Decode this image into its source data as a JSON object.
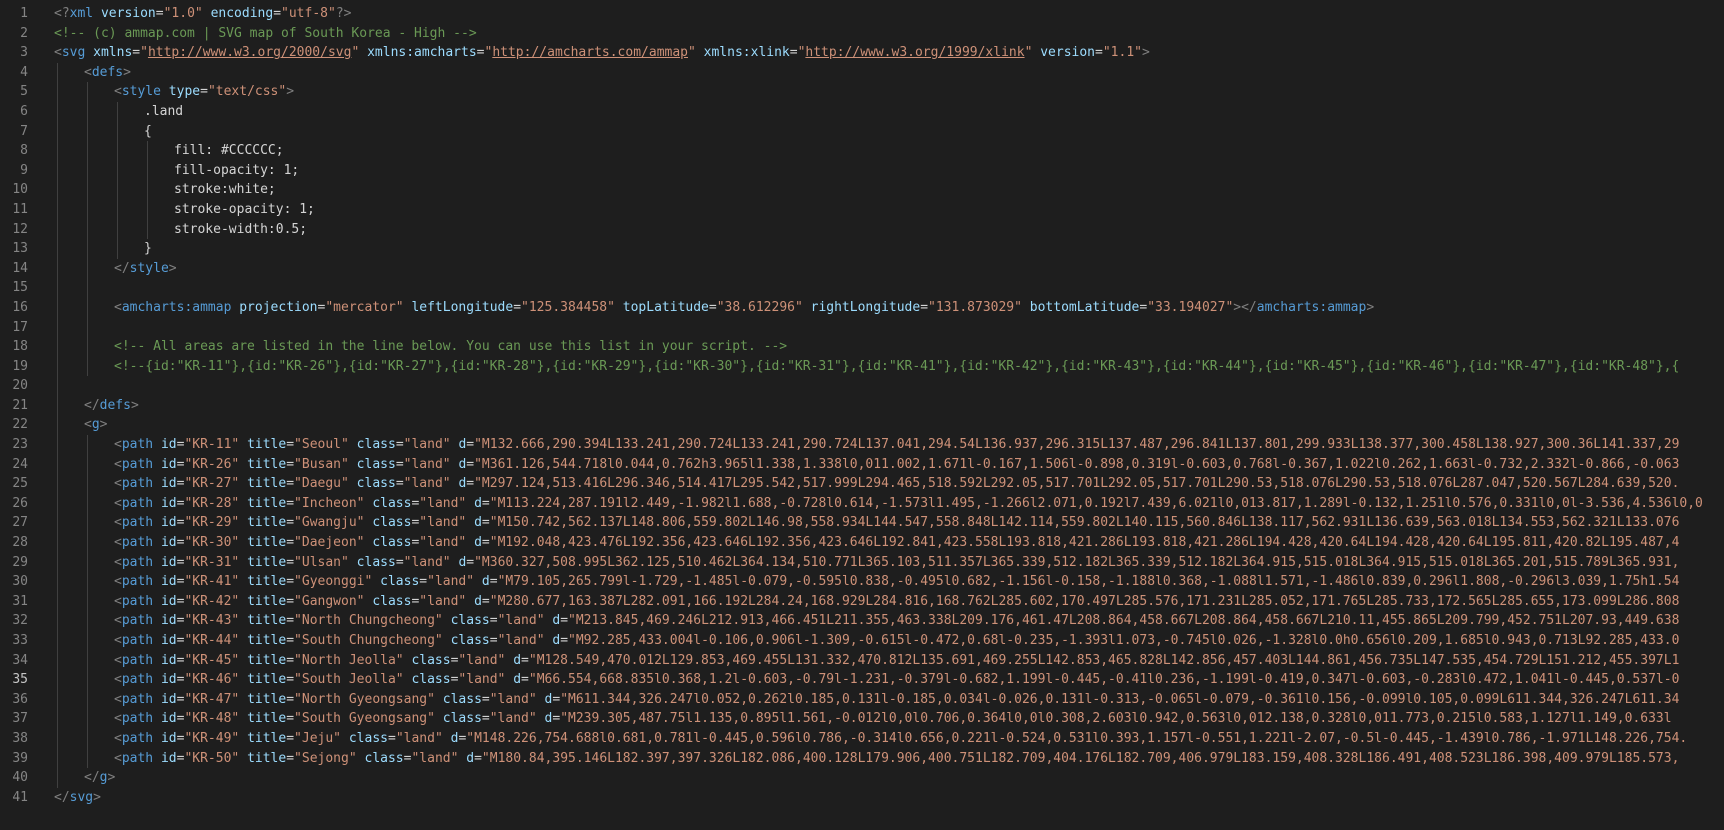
{
  "editor": {
    "lines": [
      {
        "n": "1",
        "indent": 0,
        "tokens": [
          {
            "t": "<?",
            "c": "punc"
          },
          {
            "t": "xml",
            "c": "tag"
          },
          {
            "t": " ",
            "c": "text"
          },
          {
            "t": "version",
            "c": "attr"
          },
          {
            "t": "=",
            "c": "eq"
          },
          {
            "t": "\"1.0\"",
            "c": "str"
          },
          {
            "t": " ",
            "c": "text"
          },
          {
            "t": "encoding",
            "c": "attr"
          },
          {
            "t": "=",
            "c": "eq"
          },
          {
            "t": "\"utf-8\"",
            "c": "str"
          },
          {
            "t": "?>",
            "c": "punc"
          }
        ]
      },
      {
        "n": "2",
        "indent": 0,
        "tokens": [
          {
            "t": "<!-- (c) ammap.com | SVG map of South Korea - High -->",
            "c": "comment"
          }
        ]
      },
      {
        "n": "3",
        "indent": 0,
        "tokens": [
          {
            "t": "<",
            "c": "punc"
          },
          {
            "t": "svg",
            "c": "tag"
          },
          {
            "t": " ",
            "c": "text"
          },
          {
            "t": "xmlns",
            "c": "attr"
          },
          {
            "t": "=",
            "c": "eq"
          },
          {
            "t": "\"",
            "c": "str"
          },
          {
            "t": "http://www.w3.org/2000/svg",
            "c": "link"
          },
          {
            "t": "\"",
            "c": "str"
          },
          {
            "t": " ",
            "c": "text"
          },
          {
            "t": "xmlns:amcharts",
            "c": "attr"
          },
          {
            "t": "=",
            "c": "eq"
          },
          {
            "t": "\"",
            "c": "str"
          },
          {
            "t": "http://amcharts.com/ammap",
            "c": "link"
          },
          {
            "t": "\"",
            "c": "str"
          },
          {
            "t": " ",
            "c": "text"
          },
          {
            "t": "xmlns:xlink",
            "c": "attr"
          },
          {
            "t": "=",
            "c": "eq"
          },
          {
            "t": "\"",
            "c": "str"
          },
          {
            "t": "http://www.w3.org/1999/xlink",
            "c": "link"
          },
          {
            "t": "\"",
            "c": "str"
          },
          {
            "t": " ",
            "c": "text"
          },
          {
            "t": "version",
            "c": "attr"
          },
          {
            "t": "=",
            "c": "eq"
          },
          {
            "t": "\"1.1\"",
            "c": "str"
          },
          {
            "t": ">",
            "c": "punc"
          }
        ]
      },
      {
        "n": "4",
        "indent": 1,
        "tokens": [
          {
            "t": "<",
            "c": "punc"
          },
          {
            "t": "defs",
            "c": "tag"
          },
          {
            "t": ">",
            "c": "punc"
          }
        ]
      },
      {
        "n": "5",
        "indent": 2,
        "tokens": [
          {
            "t": "<",
            "c": "punc"
          },
          {
            "t": "style",
            "c": "tag"
          },
          {
            "t": " ",
            "c": "text"
          },
          {
            "t": "type",
            "c": "attr"
          },
          {
            "t": "=",
            "c": "eq"
          },
          {
            "t": "\"text/css\"",
            "c": "str"
          },
          {
            "t": ">",
            "c": "punc"
          }
        ]
      },
      {
        "n": "6",
        "indent": 3,
        "tokens": [
          {
            "t": ".land",
            "c": "text"
          }
        ]
      },
      {
        "n": "7",
        "indent": 3,
        "tokens": [
          {
            "t": "{",
            "c": "text"
          }
        ]
      },
      {
        "n": "8",
        "indent": 4,
        "tokens": [
          {
            "t": "fill: #CCCCCC;",
            "c": "text"
          }
        ]
      },
      {
        "n": "9",
        "indent": 4,
        "tokens": [
          {
            "t": "fill-opacity: 1;",
            "c": "text"
          }
        ]
      },
      {
        "n": "10",
        "indent": 4,
        "tokens": [
          {
            "t": "stroke:white;",
            "c": "text"
          }
        ]
      },
      {
        "n": "11",
        "indent": 4,
        "tokens": [
          {
            "t": "stroke-opacity: 1;",
            "c": "text"
          }
        ]
      },
      {
        "n": "12",
        "indent": 4,
        "tokens": [
          {
            "t": "stroke-width:0.5;",
            "c": "text"
          }
        ]
      },
      {
        "n": "13",
        "indent": 3,
        "tokens": [
          {
            "t": "}",
            "c": "text"
          }
        ]
      },
      {
        "n": "14",
        "indent": 2,
        "tokens": [
          {
            "t": "</",
            "c": "punc"
          },
          {
            "t": "style",
            "c": "tag"
          },
          {
            "t": ">",
            "c": "punc"
          }
        ]
      },
      {
        "n": "15",
        "indent": 2,
        "tokens": []
      },
      {
        "n": "16",
        "indent": 2,
        "tokens": [
          {
            "t": "<",
            "c": "punc"
          },
          {
            "t": "amcharts:ammap",
            "c": "tag"
          },
          {
            "t": " ",
            "c": "text"
          },
          {
            "t": "projection",
            "c": "attr"
          },
          {
            "t": "=",
            "c": "eq"
          },
          {
            "t": "\"mercator\"",
            "c": "str"
          },
          {
            "t": " ",
            "c": "text"
          },
          {
            "t": "leftLongitude",
            "c": "attr"
          },
          {
            "t": "=",
            "c": "eq"
          },
          {
            "t": "\"125.384458\"",
            "c": "str"
          },
          {
            "t": " ",
            "c": "text"
          },
          {
            "t": "topLatitude",
            "c": "attr"
          },
          {
            "t": "=",
            "c": "eq"
          },
          {
            "t": "\"38.612296\"",
            "c": "str"
          },
          {
            "t": " ",
            "c": "text"
          },
          {
            "t": "rightLongitude",
            "c": "attr"
          },
          {
            "t": "=",
            "c": "eq"
          },
          {
            "t": "\"131.873029\"",
            "c": "str"
          },
          {
            "t": " ",
            "c": "text"
          },
          {
            "t": "bottomLatitude",
            "c": "attr"
          },
          {
            "t": "=",
            "c": "eq"
          },
          {
            "t": "\"33.194027\"",
            "c": "str"
          },
          {
            "t": "></",
            "c": "punc"
          },
          {
            "t": "amcharts:ammap",
            "c": "tag"
          },
          {
            "t": ">",
            "c": "punc"
          }
        ]
      },
      {
        "n": "17",
        "indent": 2,
        "tokens": []
      },
      {
        "n": "18",
        "indent": 2,
        "tokens": [
          {
            "t": "<!-- All areas are listed in the line below. You can use this list in your script. -->",
            "c": "comment"
          }
        ]
      },
      {
        "n": "19",
        "indent": 2,
        "tokens": [
          {
            "t": "<!--{id:\"KR-11\"},{id:\"KR-26\"},{id:\"KR-27\"},{id:\"KR-28\"},{id:\"KR-29\"},{id:\"KR-30\"},{id:\"KR-31\"},{id:\"KR-41\"},{id:\"KR-42\"},{id:\"KR-43\"},{id:\"KR-44\"},{id:\"KR-45\"},{id:\"KR-46\"},{id:\"KR-47\"},{id:\"KR-48\"},{",
            "c": "comment"
          }
        ]
      },
      {
        "n": "20",
        "indent": 1,
        "tokens": []
      },
      {
        "n": "21",
        "indent": 1,
        "tokens": [
          {
            "t": "</",
            "c": "punc"
          },
          {
            "t": "defs",
            "c": "tag"
          },
          {
            "t": ">",
            "c": "punc"
          }
        ]
      },
      {
        "n": "22",
        "indent": 1,
        "tokens": [
          {
            "t": "<",
            "c": "punc"
          },
          {
            "t": "g",
            "c": "tag"
          },
          {
            "t": ">",
            "c": "punc"
          }
        ]
      },
      {
        "n": "23",
        "indent": 2,
        "path": true,
        "id": "\"KR-11\"",
        "title": "\"Seoul\"",
        "d": "\"M132.666,290.394L133.241,290.724L133.241,290.724L137.041,294.54L136.937,296.315L137.487,296.841L137.801,299.933L138.377,300.458L138.927,300.36L141.337,29"
      },
      {
        "n": "24",
        "indent": 2,
        "path": true,
        "id": "\"KR-26\"",
        "title": "\"Busan\"",
        "d": "\"M361.126,544.718l0.044,0.762h3.965l1.338,1.338l0,011.002,1.671l-0.167,1.506l-0.898,0.319l-0.603,0.768l-0.367,1.022l0.262,1.663l-0.732,2.332l-0.866,-0.063"
      },
      {
        "n": "25",
        "indent": 2,
        "path": true,
        "id": "\"KR-27\"",
        "title": "\"Daegu\"",
        "d": "\"M297.124,513.416L296.346,514.417L295.542,517.999L294.465,518.592L292.05,517.701L292.05,517.701L290.53,518.076L290.53,518.076L287.047,520.567L284.639,520."
      },
      {
        "n": "26",
        "indent": 2,
        "path": true,
        "id": "\"KR-28\"",
        "title": "\"Incheon\"",
        "d": "\"M113.224,287.191l2.449,-1.982l1.688,-0.728l0.614,-1.573l1.495,-1.266l2.071,0.192l7.439,6.021l0,013.817,1.289l-0.132,1.251l0.576,0.331l0,0l-3.536,4.536l0,0"
      },
      {
        "n": "27",
        "indent": 2,
        "path": true,
        "id": "\"KR-29\"",
        "title": "\"Gwangju\"",
        "d": "\"M150.742,562.137L148.806,559.802L146.98,558.934L144.547,558.848L142.114,559.802L140.115,560.846L138.117,562.931L136.639,563.018L134.553,562.321L133.076"
      },
      {
        "n": "28",
        "indent": 2,
        "path": true,
        "id": "\"KR-30\"",
        "title": "\"Daejeon\"",
        "d": "\"M192.048,423.476L192.356,423.646L192.356,423.646L192.841,423.558L193.818,421.286L193.818,421.286L194.428,420.64L194.428,420.64L195.811,420.82L195.487,4"
      },
      {
        "n": "29",
        "indent": 2,
        "path": true,
        "id": "\"KR-31\"",
        "title": "\"Ulsan\"",
        "d": "\"M360.327,508.995L362.125,510.462L364.134,510.771L365.103,511.357L365.339,512.182L365.339,512.182L364.915,515.018L364.915,515.018L365.201,515.789L365.931,"
      },
      {
        "n": "30",
        "indent": 2,
        "path": true,
        "id": "\"KR-41\"",
        "title": "\"Gyeonggi\"",
        "d": "\"M79.105,265.799l-1.729,-1.485l-0.079,-0.595l0.838,-0.495l0.682,-1.156l-0.158,-1.188l0.368,-1.088l1.571,-1.486l0.839,0.296l1.808,-0.296l3.039,1.75h1.54"
      },
      {
        "n": "31",
        "indent": 2,
        "path": true,
        "id": "\"KR-42\"",
        "title": "\"Gangwon\"",
        "d": "\"M280.677,163.387L282.091,166.192L284.24,168.929L284.816,168.762L285.602,170.497L285.576,171.231L285.052,171.765L285.733,172.565L285.655,173.099L286.808"
      },
      {
        "n": "32",
        "indent": 2,
        "path": true,
        "id": "\"KR-43\"",
        "title": "\"North Chungcheong\"",
        "d": "\"M213.845,469.246L212.913,466.451L211.355,463.338L209.176,461.47L208.864,458.667L208.864,458.667L210.11,455.865L209.799,452.751L207.93,449.638"
      },
      {
        "n": "33",
        "indent": 2,
        "path": true,
        "id": "\"KR-44\"",
        "title": "\"South Chungcheong\"",
        "d": "\"M92.285,433.004l-0.106,0.906l-1.309,-0.615l-0.472,0.68l-0.235,-1.393l1.073,-0.745l0.026,-1.328l0.0h0.656l0.209,1.685l0.943,0.713L92.285,433.0"
      },
      {
        "n": "34",
        "indent": 2,
        "path": true,
        "id": "\"KR-45\"",
        "title": "\"North Jeolla\"",
        "d": "\"M128.549,470.012L129.853,469.455L131.332,470.812L135.691,469.255L142.853,465.828L142.856,457.403L144.861,456.735L147.535,454.729L151.212,455.397L1"
      },
      {
        "n": "35",
        "indent": 2,
        "path": true,
        "current": true,
        "id": "\"KR-46\"",
        "title": "\"South Jeolla\"",
        "d": "\"M66.554,668.835l0.368,1.2l-0.603,-0.79l-1.231,-0.379l-0.682,1.199l-0.445,-0.41l0.236,-1.199l-0.419,0.347l-0.603,-0.283l0.472,1.041l-0.445,0.537l-0"
      },
      {
        "n": "36",
        "indent": 2,
        "path": true,
        "id": "\"KR-47\"",
        "title": "\"North Gyeongsang\"",
        "d": "\"M611.344,326.247l0.052,0.262l0.185,0.131l-0.185,0.034l-0.026,0.131l-0.313,-0.065l-0.079,-0.361l0.156,-0.099l0.105,0.099L611.344,326.247L611.34"
      },
      {
        "n": "37",
        "indent": 2,
        "path": true,
        "id": "\"KR-48\"",
        "title": "\"South Gyeongsang\"",
        "d": "\"M239.305,487.75l1.135,0.895l1.561,-0.012l0,0l0.706,0.364l0,0l0.308,2.603l0.942,0.563l0,012.138,0.328l0,011.773,0.215l0.583,1.127l1.149,0.633l"
      },
      {
        "n": "38",
        "indent": 2,
        "path": true,
        "id": "\"KR-49\"",
        "title": "\"Jeju\"",
        "d": "\"M148.226,754.688l0.681,0.781l-0.445,0.596l0.786,-0.314l0.656,0.221l-0.524,0.531l0.393,1.157l-0.551,1.221l-2.07,-0.5l-0.445,-1.439l0.786,-1.971L148.226,754."
      },
      {
        "n": "39",
        "indent": 2,
        "path": true,
        "id": "\"KR-50\"",
        "title": "\"Sejong\"",
        "d": "\"M180.84,395.146L182.397,397.326L182.086,400.128L179.906,400.751L182.709,404.176L182.709,406.979L183.159,408.328L186.491,408.523L186.398,409.979L185.573,"
      },
      {
        "n": "40",
        "indent": 1,
        "tokens": [
          {
            "t": "</",
            "c": "punc"
          },
          {
            "t": "g",
            "c": "tag"
          },
          {
            "t": ">",
            "c": "punc"
          }
        ]
      },
      {
        "n": "41",
        "indent": 0,
        "tokens": [
          {
            "t": "</",
            "c": "punc"
          },
          {
            "t": "svg",
            "c": "tag"
          },
          {
            "t": ">",
            "c": "punc"
          }
        ]
      }
    ],
    "path_tokens": {
      "open": "<",
      "tag": "path",
      "id_attr": "id",
      "title_attr": "title",
      "class_attr": "class",
      "class_value": "\"land\"",
      "d_attr": "d",
      "eq": "="
    },
    "colors": {
      "background": "#1e1e1e",
      "gutter": "#858585",
      "tag": "#569cd6",
      "attr": "#9cdcfe",
      "string": "#ce9178",
      "comment": "#6a9955",
      "punctuation": "#808080",
      "text": "#d4d4d4"
    }
  }
}
